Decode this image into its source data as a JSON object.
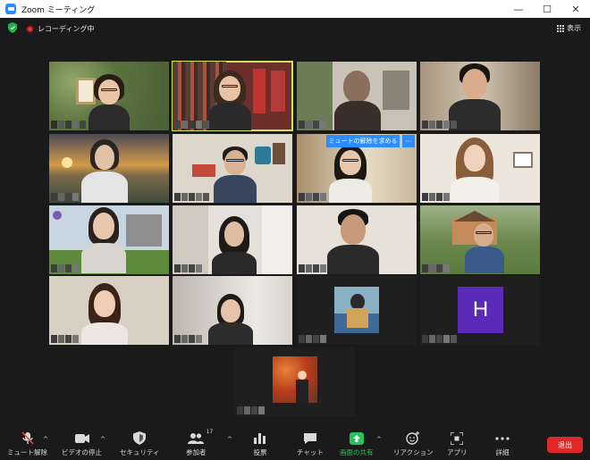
{
  "window": {
    "title": "Zoom ミーティング",
    "controls": {
      "minimize": "—",
      "maximize": "☐",
      "close": "✕"
    }
  },
  "topbar": {
    "recording_label": "レコーディング中",
    "view_label": "表示"
  },
  "gallery": {
    "raise_hand_banner": "ミュートの解除を求める",
    "more_button": "···",
    "avatar_letter": "H"
  },
  "toolbar": {
    "items": [
      {
        "label": "ミュート解除",
        "icon": "muted-mic-icon"
      },
      {
        "label": "ビデオの停止",
        "icon": "video-camera-icon"
      },
      {
        "label": "セキュリティ",
        "icon": "shield-icon"
      },
      {
        "label": "参加者",
        "icon": "participants-icon",
        "count": "17"
      },
      {
        "label": "投票",
        "icon": "bar-chart-icon"
      },
      {
        "label": "チャット",
        "icon": "chat-bubble-icon"
      },
      {
        "label": "画面の共有",
        "icon": "share-screen-icon"
      },
      {
        "label": "リアクション",
        "icon": "reaction-icon"
      },
      {
        "label": "アプリ",
        "icon": "apps-icon"
      },
      {
        "label": "詳細",
        "icon": "more-icon"
      }
    ],
    "leave_label": "退出"
  },
  "colors": {
    "accent_blue": "#2d8cff",
    "speaker_border": "#c9e45a",
    "share_green": "#24c35b",
    "leave_red": "#e02828",
    "avatar_purple": "#5a2ab8"
  }
}
